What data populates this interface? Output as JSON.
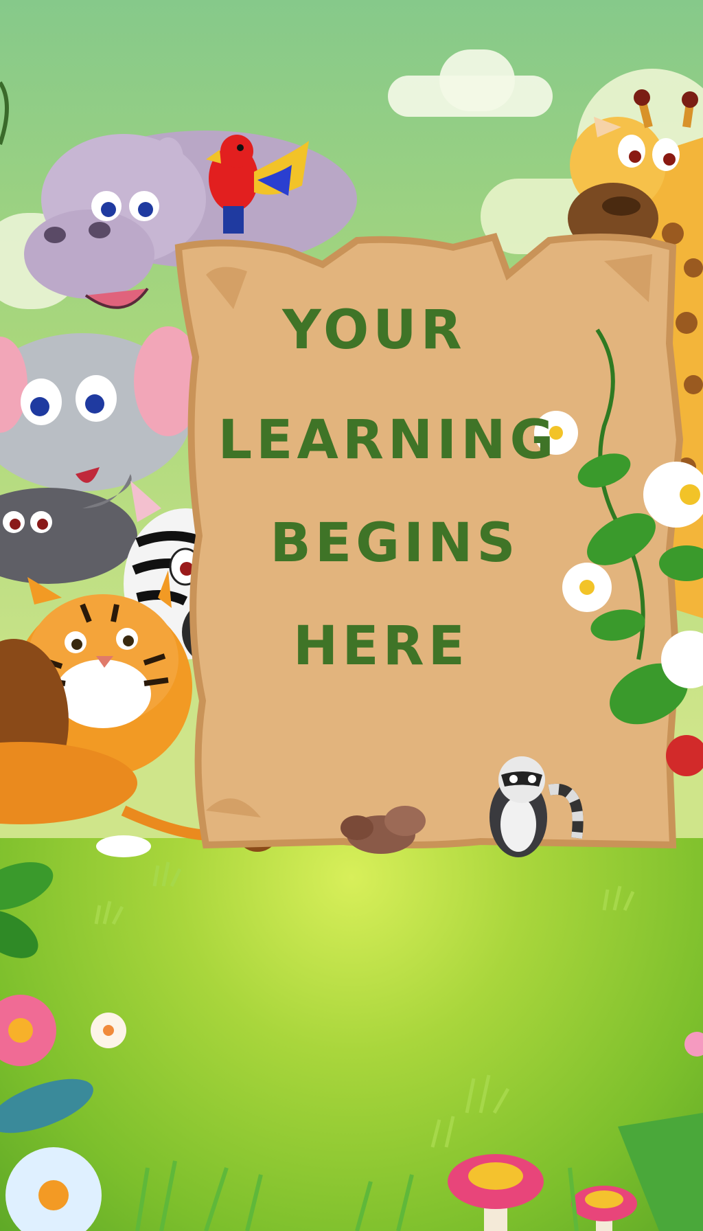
{
  "poster": {
    "lines": [
      "YOUR",
      "LEARNING",
      "BEGINS",
      "HERE"
    ]
  },
  "colors": {
    "text": "#3f7427",
    "scroll": "#e2b47d",
    "scroll_edge": "#c99358",
    "grass": "#9fd23a",
    "sky": "#9ad382"
  },
  "scene_items": [
    "hippo",
    "parrot",
    "elephant",
    "buffalo",
    "zebra",
    "tiger",
    "lion",
    "giraffe",
    "raccoon",
    "daisies",
    "vines",
    "mushrooms",
    "pink-flower",
    "clouds"
  ]
}
